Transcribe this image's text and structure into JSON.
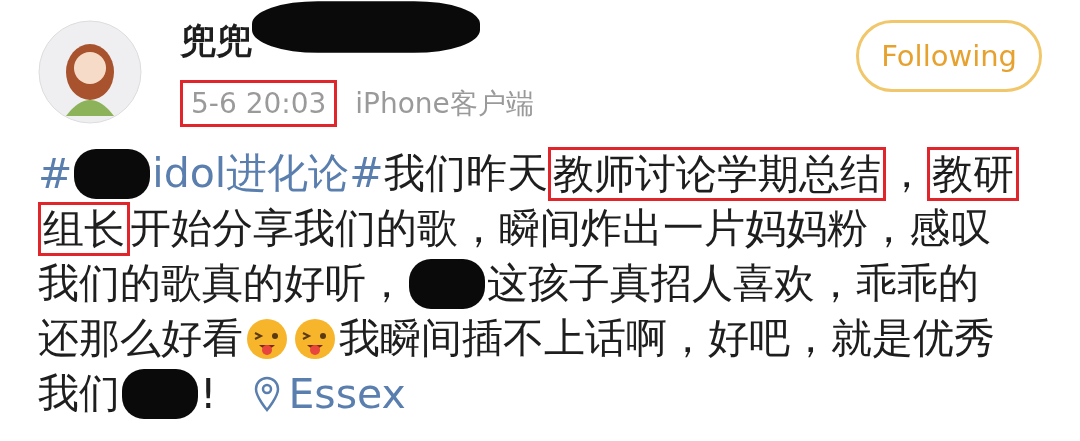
{
  "author": {
    "name": "兜兜",
    "time": "5-6 20:03",
    "time_marked": true,
    "source": "iPhone客户端"
  },
  "follow_button": {
    "label": "Following"
  },
  "post": {
    "lines": [
      [
        {
          "kind": "hashtag",
          "text": "#"
        },
        {
          "kind": "redaction"
        },
        {
          "kind": "hashtag",
          "text": "idol进化论#"
        },
        {
          "kind": "text",
          "text": "我们昨天"
        },
        {
          "kind": "marked",
          "text": "教师讨论学期总结"
        },
        {
          "kind": "text",
          "text": "，"
        },
        {
          "kind": "marked",
          "text": "教研"
        }
      ],
      [
        {
          "kind": "marked",
          "text": "组长"
        },
        {
          "kind": "text",
          "text": "开始分享我们的歌，瞬间炸出一片妈妈粉，感叹"
        }
      ],
      [
        {
          "kind": "text",
          "text": "我们的歌真的好听，"
        },
        {
          "kind": "redaction"
        },
        {
          "kind": "text",
          "text": "这孩子真招人喜欢，乖乖的"
        }
      ],
      [
        {
          "kind": "text",
          "text": "还那么好看"
        },
        {
          "kind": "emoji"
        },
        {
          "kind": "emoji"
        },
        {
          "kind": "text",
          "text": "我瞬间插不上话啊，好吧，就是优秀"
        }
      ],
      [
        {
          "kind": "text",
          "text": "我们"
        },
        {
          "kind": "redaction"
        },
        {
          "kind": "text",
          "text": "!"
        },
        {
          "kind": "location",
          "text": "Essex"
        }
      ]
    ]
  }
}
